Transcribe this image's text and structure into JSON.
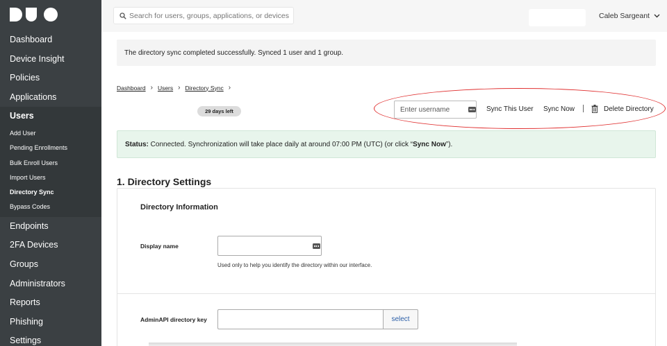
{
  "sidebar": {
    "items_top": [
      "Dashboard",
      "Device Insight",
      "Policies",
      "Applications"
    ],
    "group_label": "Users",
    "sub_items": [
      "Add User",
      "Pending Enrollments",
      "Bulk Enroll Users",
      "Import Users",
      "Directory Sync",
      "Bypass Codes"
    ],
    "items_bottom": [
      "Endpoints",
      "2FA Devices",
      "Groups",
      "Administrators",
      "Reports",
      "Phishing",
      "Settings"
    ]
  },
  "topbar": {
    "search_placeholder": "Search for users, groups, applications, or devices",
    "user_name": "Caleb Sargeant"
  },
  "banner": {
    "message": "The directory sync completed successfully. Synced 1 user and 1 group."
  },
  "breadcrumb": [
    "Dashboard",
    "Users",
    "Directory Sync"
  ],
  "trial": {
    "days_left": "29 days left"
  },
  "toolbar": {
    "username_placeholder": "Enter username",
    "sync_user": "Sync This User",
    "sync_now": "Sync Now",
    "delete": "Delete Directory"
  },
  "status": {
    "label": "Status:",
    "text_before": " Connected. Synchronization will take place daily at around 07:00 PM (UTC) (or click “",
    "link": "Sync Now",
    "text_after": "”)."
  },
  "section": {
    "title": "1. Directory Settings",
    "heading": "Directory Information",
    "display_name_label": "Display name",
    "display_name_value": "",
    "display_help": "Used only to help you identify the directory within our interface.",
    "key_label": "AdminAPI directory key",
    "key_value": "",
    "select_label": "select"
  }
}
